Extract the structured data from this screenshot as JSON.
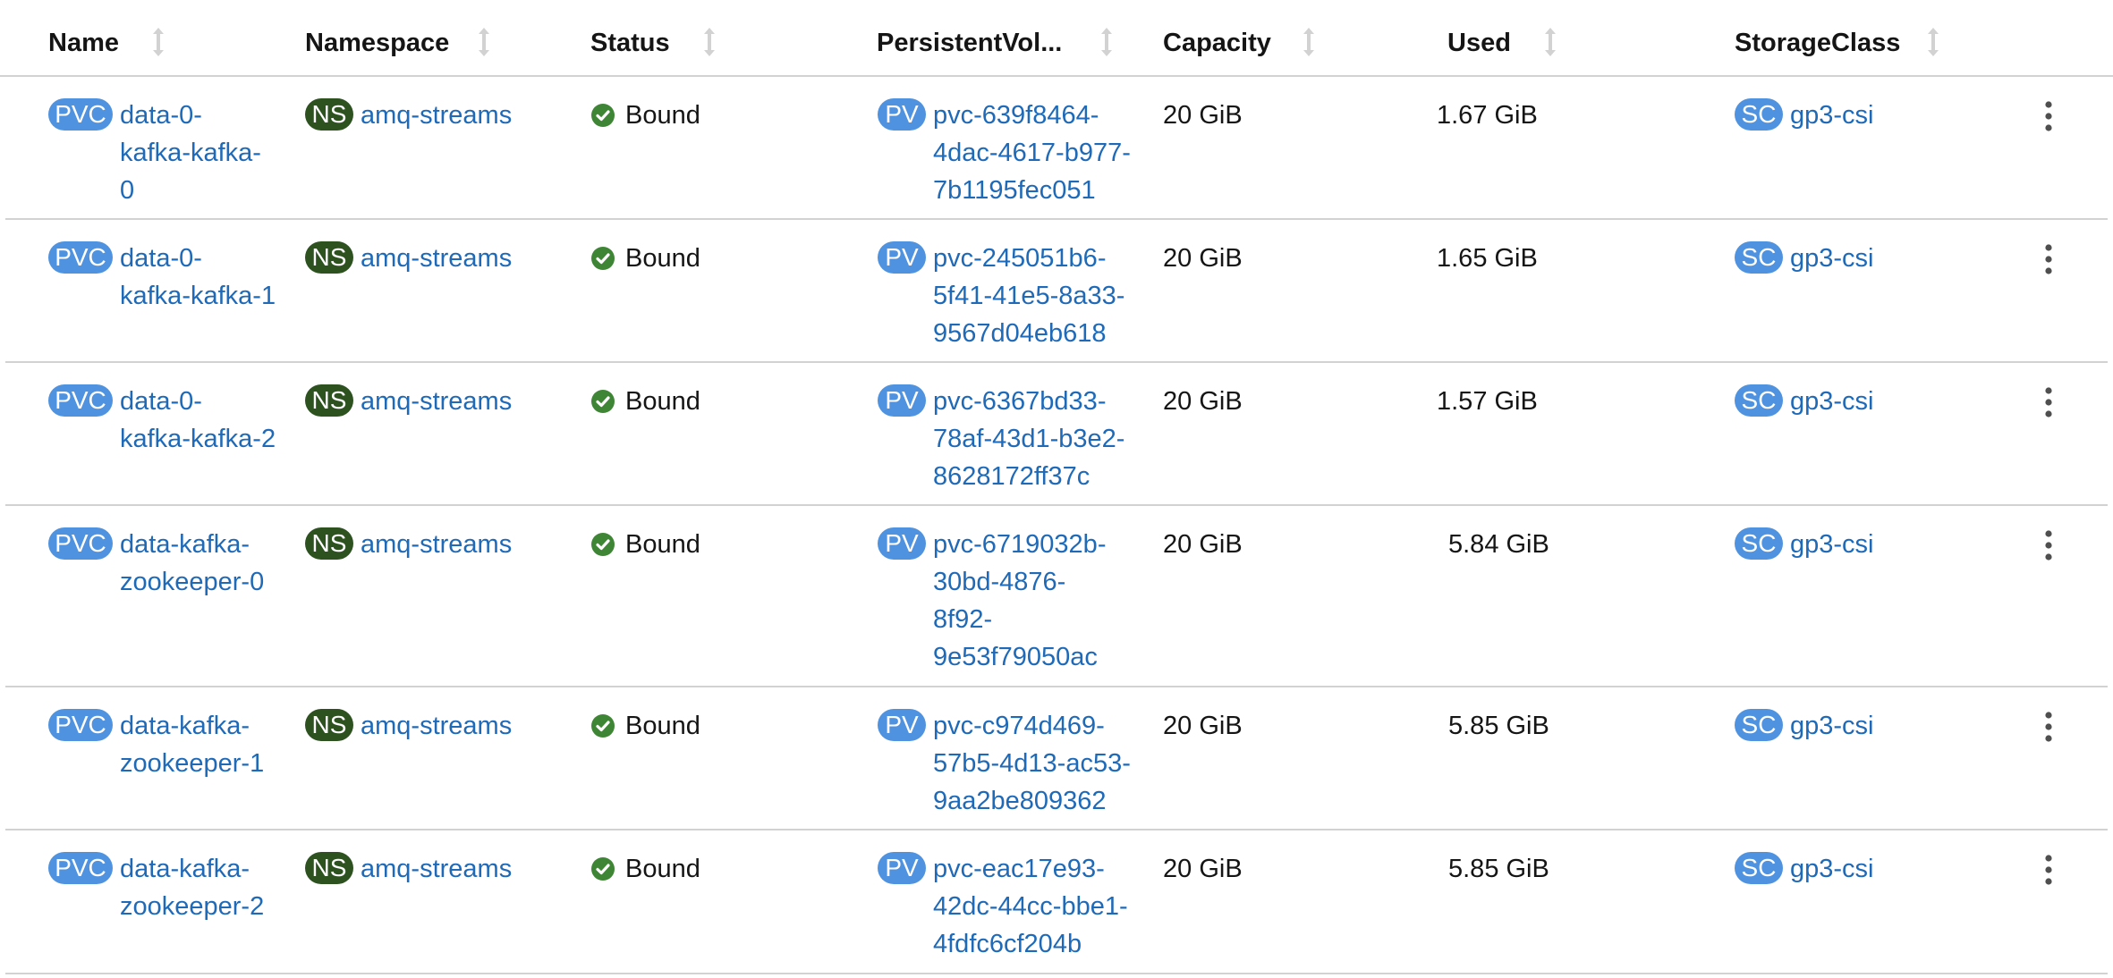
{
  "colors": {
    "link": "#1f6ab8",
    "badge_blue": "#4f93e0",
    "badge_ns": "#2d5220",
    "status_bound": "#3e8635",
    "divider": "#d2d2d2"
  },
  "columns": [
    {
      "label": "Name"
    },
    {
      "label": "Namespace"
    },
    {
      "label": "Status"
    },
    {
      "label": "PersistentVol..."
    },
    {
      "label": "Capacity"
    },
    {
      "label": "Used"
    },
    {
      "label": "StorageClass"
    }
  ],
  "badges": {
    "pvc": "PVC",
    "ns": "NS",
    "pv": "PV",
    "sc": "SC"
  },
  "icons": {
    "sort": "sort-arrows-icon",
    "status": "check-circle-icon",
    "menu": "kebab-menu-icon"
  },
  "rows": [
    {
      "name_lines": [
        "data-0-",
        "kafka-kafka-",
        "0"
      ],
      "namespace": "amq-streams",
      "status": "Bound",
      "pv_lines": [
        "pvc-639f8464-",
        "4dac-4617-b977-",
        "7b1195fec051"
      ],
      "capacity": "20 GiB",
      "used": "1.67 GiB",
      "storage_class": "gp3-csi"
    },
    {
      "name_lines": [
        "data-0-",
        "kafka-kafka-1"
      ],
      "namespace": "amq-streams",
      "status": "Bound",
      "pv_lines": [
        "pvc-245051b6-",
        "5f41-41e5-8a33-",
        "9567d04eb618"
      ],
      "capacity": "20 GiB",
      "used": "1.65 GiB",
      "storage_class": "gp3-csi"
    },
    {
      "name_lines": [
        "data-0-",
        "kafka-kafka-2"
      ],
      "namespace": "amq-streams",
      "status": "Bound",
      "pv_lines": [
        "pvc-6367bd33-",
        "78af-43d1-b3e2-",
        "8628172ff37c"
      ],
      "capacity": "20 GiB",
      "used": "1.57 GiB",
      "storage_class": "gp3-csi"
    },
    {
      "name_lines": [
        "data-kafka-",
        "zookeeper-0"
      ],
      "namespace": "amq-streams",
      "status": "Bound",
      "pv_lines": [
        "pvc-6719032b-",
        "30bd-4876-",
        "8f92-",
        "9e53f79050ac"
      ],
      "capacity": "20 GiB",
      "used": "5.84 GiB",
      "storage_class": "gp3-csi"
    },
    {
      "name_lines": [
        "data-kafka-",
        "zookeeper-1"
      ],
      "namespace": "amq-streams",
      "status": "Bound",
      "pv_lines": [
        "pvc-c974d469-",
        "57b5-4d13-ac53-",
        "9aa2be809362"
      ],
      "capacity": "20 GiB",
      "used": "5.85 GiB",
      "storage_class": "gp3-csi"
    },
    {
      "name_lines": [
        "data-kafka-",
        "zookeeper-2"
      ],
      "namespace": "amq-streams",
      "status": "Bound",
      "pv_lines": [
        "pvc-eac17e93-",
        "42dc-44cc-bbe1-",
        "4fdfc6cf204b"
      ],
      "capacity": "20 GiB",
      "used": "5.85 GiB",
      "storage_class": "gp3-csi"
    }
  ]
}
